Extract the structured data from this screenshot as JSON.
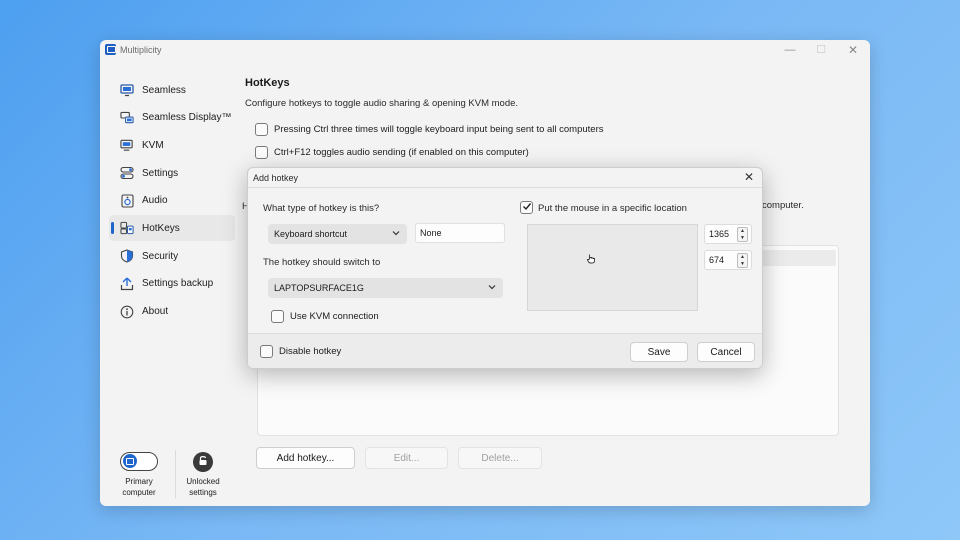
{
  "window": {
    "title": "Multiplicity",
    "controls": {
      "minimize": "—",
      "maximize": "☐",
      "close": "✕"
    }
  },
  "sidebar": {
    "items": [
      {
        "label": "Seamless",
        "icon": "monitor-icon",
        "active": false
      },
      {
        "label": "Seamless Display™",
        "icon": "display-share-icon",
        "active": false
      },
      {
        "label": "KVM",
        "icon": "kvm-icon",
        "active": false
      },
      {
        "label": "Settings",
        "icon": "settings-toggle-icon",
        "active": false
      },
      {
        "label": "Audio",
        "icon": "speaker-icon",
        "active": false
      },
      {
        "label": "HotKeys",
        "icon": "hotkeys-icon",
        "active": true
      },
      {
        "label": "Security",
        "icon": "shield-icon",
        "active": false
      },
      {
        "label": "Settings backup",
        "icon": "upload-icon",
        "active": false
      },
      {
        "label": "About",
        "icon": "info-icon",
        "active": false
      }
    ],
    "bottom": {
      "primary_label_1": "Primary",
      "primary_label_2": "computer",
      "unlocked_label_1": "Unlocked",
      "unlocked_label_2": "settings"
    }
  },
  "main": {
    "heading": "HotKeys",
    "description": "Configure hotkeys to toggle audio sharing & opening KVM mode.",
    "options": [
      {
        "label": "Pressing Ctrl three times will toggle keyboard input being sent to all computers",
        "checked": false
      },
      {
        "label": "Ctrl+F12 toggles audio sending (if enabled on this computer)",
        "checked": false
      }
    ],
    "hint_left": "H",
    "hint_right": "computer.",
    "buttons": {
      "add": "Add hotkey...",
      "edit": "Edit...",
      "delete": "Delete..."
    }
  },
  "dialog": {
    "title": "Add hotkey",
    "close": "✕",
    "type_label": "What type of hotkey is this?",
    "type_value": "Keyboard shortcut",
    "shortcut_value": "None",
    "switch_label": "The hotkey should switch to",
    "switch_value": "LAPTOPSURFACE1G",
    "use_kvm_label": "Use KVM connection",
    "use_kvm_checked": false,
    "mouse_label": "Put the mouse in a specific location",
    "mouse_checked": true,
    "mouse_x": "1365",
    "mouse_y": "674",
    "disable_label": "Disable hotkey",
    "disable_checked": false,
    "save": "Save",
    "cancel": "Cancel"
  },
  "colors": {
    "accent": "#1f66cc",
    "background_gradient_start": "#4d9ff0",
    "background_gradient_end": "#8ec7f8"
  }
}
